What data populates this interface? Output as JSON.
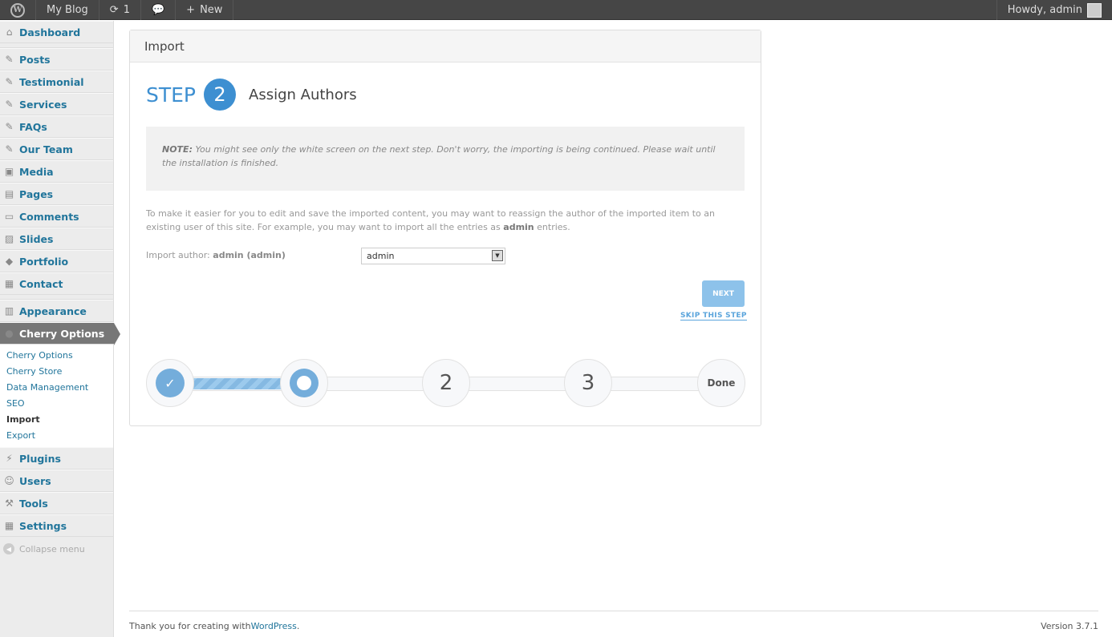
{
  "adminbar": {
    "site": "My Blog",
    "updates": "1",
    "new": "New",
    "howdy": "Howdy, admin"
  },
  "sidebar": {
    "items": [
      {
        "label": "Dashboard",
        "icon": "⌂"
      },
      {
        "label": "Posts",
        "icon": "✎"
      },
      {
        "label": "Testimonial",
        "icon": "✎"
      },
      {
        "label": "Services",
        "icon": "✎"
      },
      {
        "label": "FAQs",
        "icon": "✎"
      },
      {
        "label": "Our Team",
        "icon": "✎"
      },
      {
        "label": "Media",
        "icon": "▣"
      },
      {
        "label": "Pages",
        "icon": "▤"
      },
      {
        "label": "Comments",
        "icon": "▭"
      },
      {
        "label": "Slides",
        "icon": "▨"
      },
      {
        "label": "Portfolio",
        "icon": "◆"
      },
      {
        "label": "Contact",
        "icon": "▦"
      },
      {
        "label": "Appearance",
        "icon": "▥"
      },
      {
        "label": "Cherry Options",
        "icon": "●"
      },
      {
        "label": "Plugins",
        "icon": "⚡"
      },
      {
        "label": "Users",
        "icon": "☺"
      },
      {
        "label": "Tools",
        "icon": "⚒"
      },
      {
        "label": "Settings",
        "icon": "▦"
      }
    ],
    "submenu": [
      "Cherry Options",
      "Cherry Store",
      "Data Management",
      "SEO",
      "Import",
      "Export"
    ],
    "collapse": "Collapse menu"
  },
  "panel": {
    "title": "Import",
    "step_word": "STEP",
    "step_num": "2",
    "step_title": "Assign Authors",
    "note_label": "NOTE:",
    "note": " You might see only the white screen on the next step. Don't worry, the importing is being continued. Please wait until the installation is finished.",
    "desc_a": "To make it easier for you to edit and save the imported content, you may want to reassign the author of the imported item to an existing user of this site. For example, you may want to import all the entries as ",
    "desc_b": "admin",
    "desc_c": " entries.",
    "author_label": "Import author: ",
    "author_name": "admin (admin)",
    "select_value": "admin",
    "next": "NEXT",
    "skip": "SKIP THIS STEP",
    "progress": {
      "fraction": 0.25,
      "nodes": [
        "✓",
        "",
        "2",
        "3",
        "Done"
      ]
    }
  },
  "footer": {
    "thanks": "Thank you for creating with ",
    "wp": "WordPress",
    "dot": ".",
    "version": "Version 3.7.1"
  }
}
